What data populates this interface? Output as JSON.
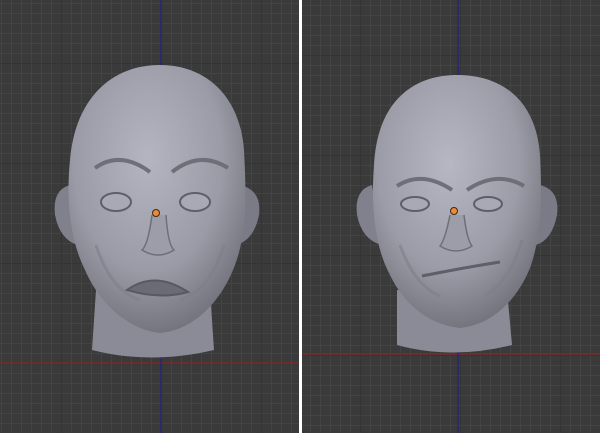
{
  "viewports": [
    {
      "name": "left-viewport",
      "expression": "sad"
    },
    {
      "name": "right-viewport",
      "expression": "smirk"
    }
  ],
  "colors": {
    "background": "#3a3a3a",
    "grid_minor": "#444444",
    "grid_major": "#343434",
    "axis_x": "#7a2a2a",
    "axis_z": "#26267a",
    "mesh": "#8e8f9a",
    "origin": "#f08a30",
    "divider": "#ffffff"
  }
}
